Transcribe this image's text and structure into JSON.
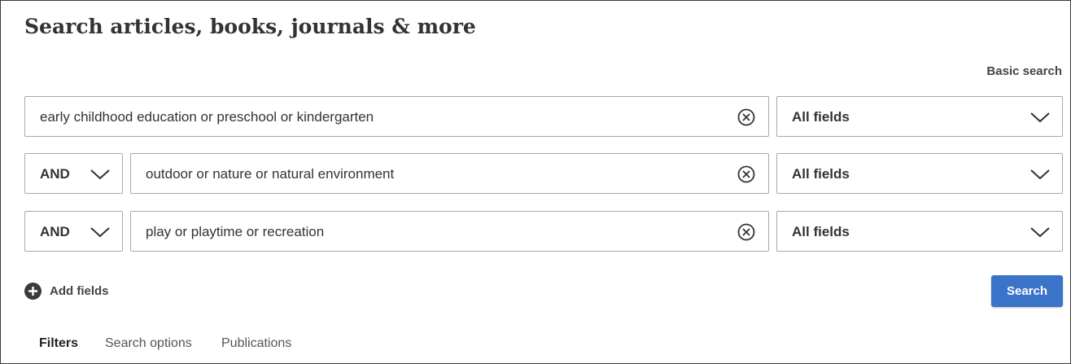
{
  "header": {
    "title": "Search articles, books, journals & more",
    "basic_search_label": "Basic search"
  },
  "rows": [
    {
      "operator": null,
      "query": "early childhood education or preschool or kindergarten",
      "field": "All fields"
    },
    {
      "operator": "AND",
      "query": "outdoor or nature or natural environment",
      "field": "All fields"
    },
    {
      "operator": "AND",
      "query": "play or playtime or recreation",
      "field": "All fields"
    }
  ],
  "actions": {
    "add_fields_label": "Add fields",
    "search_label": "Search"
  },
  "tabs": [
    {
      "label": "Filters",
      "active": true
    },
    {
      "label": "Search options",
      "active": false
    },
    {
      "label": "Publications",
      "active": false
    }
  ],
  "colors": {
    "accent": "#3b73c8",
    "border": "#a9a9a9",
    "text": "#333333"
  }
}
